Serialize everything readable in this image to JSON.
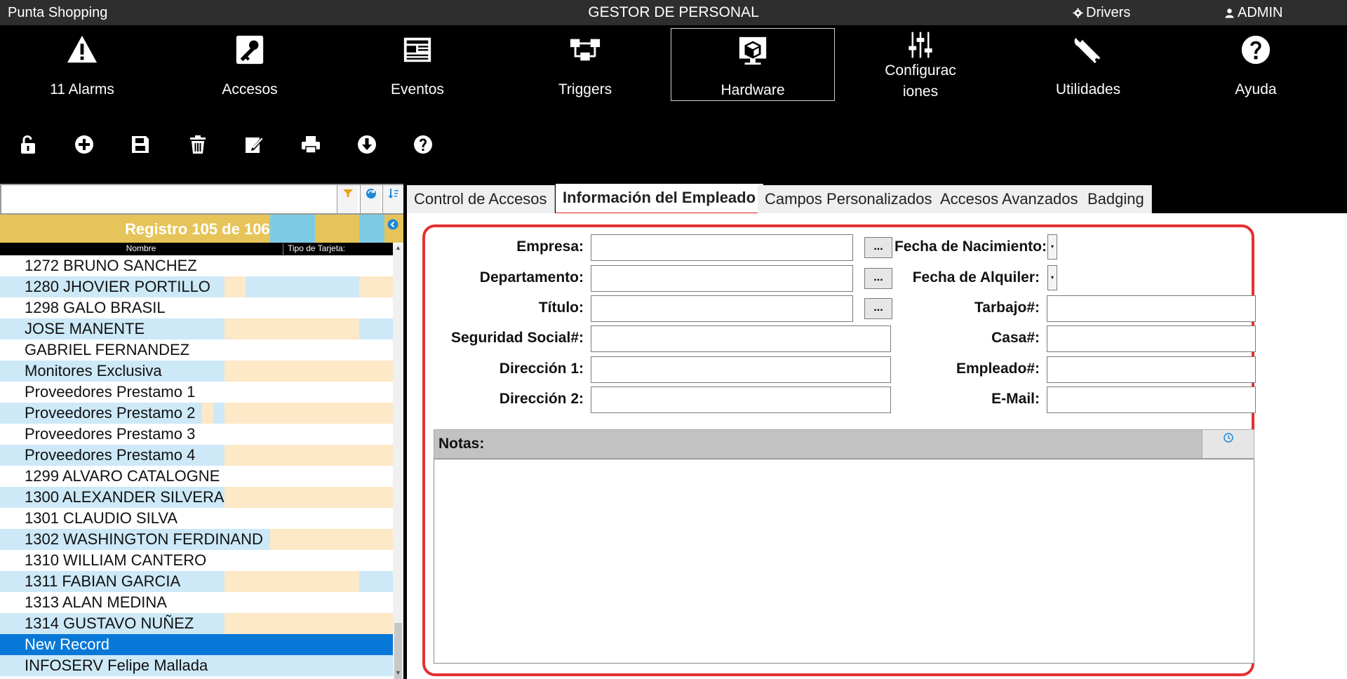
{
  "titlebar": {
    "app_title": "Punta Shopping",
    "window_title": "GESTOR DE PERSONAL",
    "drivers": "Drivers",
    "user": "ADMIN"
  },
  "ribbon": [
    {
      "label": "11 Alarms",
      "icon": "warning-icon"
    },
    {
      "label": "Accesos",
      "icon": "door-key-icon"
    },
    {
      "label": "Eventos",
      "icon": "newspaper-icon"
    },
    {
      "label": "Triggers",
      "icon": "flowchart-icon"
    },
    {
      "label": "Hardware",
      "icon": "hardware-box-icon",
      "active": true
    },
    {
      "label": "Configurac\niones",
      "icon": "sliders-icon"
    },
    {
      "label": "Utilidades",
      "icon": "wrench-icon"
    },
    {
      "label": "Ayuda",
      "icon": "help-icon"
    }
  ],
  "toolbar": [
    "unlock-icon",
    "add-icon",
    "save-icon",
    "delete-icon",
    "edit-icon",
    "print-icon",
    "download-icon",
    "help-icon"
  ],
  "list": {
    "search_value": "",
    "registro": "Registro 105 de 106",
    "col_nombre": "Nombre",
    "col_tipo": "Tipo de Tarjeta:",
    "rows": [
      "1272 BRUNO SANCHEZ",
      "1280 JHOVIER PORTILLO",
      "1298 GALO BRASIL",
      "JOSE  MANENTE",
      "GABRIEL FERNANDEZ",
      "Monitores Exclusiva",
      "Proveedores Prestamo 1",
      "Proveedores Prestamo 2",
      "Proveedores Prestamo 3",
      "Proveedores Prestamo 4",
      "1299 ALVARO CATALOGNE",
      "1300 ALEXANDER SILVERA",
      "1301 CLAUDIO SILVA",
      "1302 WASHINGTON FERDINAND",
      "1310 WILLIAM CANTERO",
      "1311 FABIAN GARCIA",
      "1313 ALAN MEDINA",
      "1314 GUSTAVO NUÑEZ",
      "New Record",
      "INFOSERV Felipe Mallada"
    ],
    "selected_index": 18
  },
  "tabs": [
    {
      "label": "Control de Accesos"
    },
    {
      "label": "Información del Empleado",
      "active": true
    },
    {
      "label": "Campos Personalizados"
    },
    {
      "label": "Accesos Avanzados"
    },
    {
      "label": "Badging"
    }
  ],
  "form": {
    "empresa": "Empresa:",
    "departamento": "Departamento:",
    "titulo": "Título:",
    "seguridad": "Seguridad Social#:",
    "direccion1": "Dirección 1:",
    "direccion2": "Dirección 2:",
    "fecha_nac": "Fecha de Nacimiento:",
    "fecha_alq": "Fecha de Alquiler:",
    "trabajo": "Tarbajo#:",
    "casa": "Casa#:",
    "empleado": "Empleado#:",
    "email": "E-Mail:",
    "dots": "...",
    "notas": "Notas:"
  },
  "colors": {
    "accent_red": "#e53030",
    "registro_bar": "#e6c45a",
    "row_blue": "#cde9f8",
    "row_peach": "#fde8c7",
    "selected_row": "#0878d8"
  }
}
